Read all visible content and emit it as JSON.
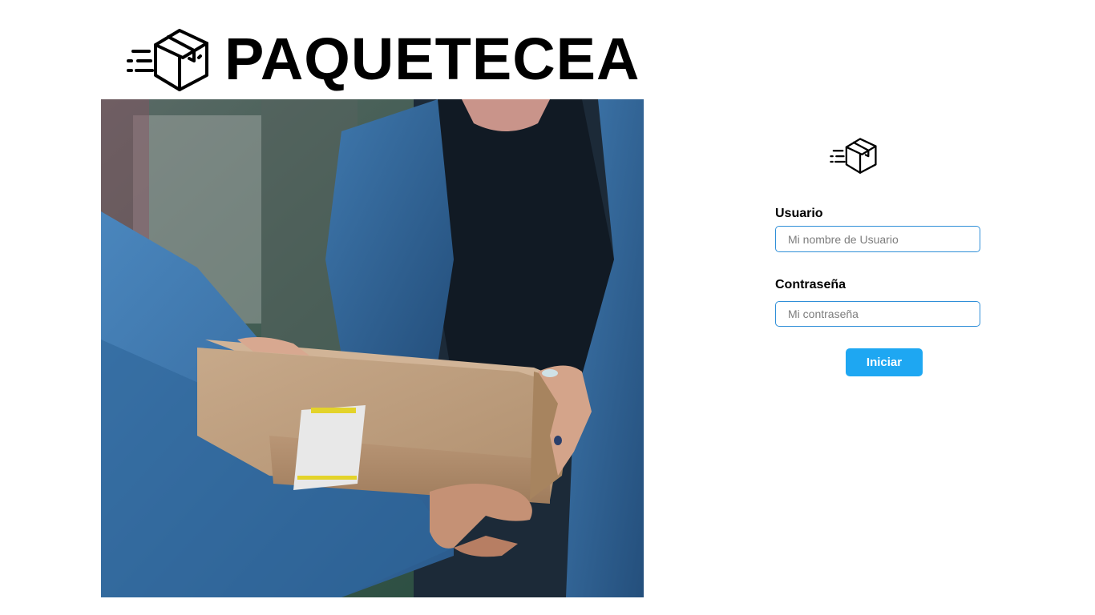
{
  "brand": {
    "name": "PAQUETECEA",
    "logo_icon": "fast-delivery-box-icon"
  },
  "hero": {
    "icon": "package-handover-photo"
  },
  "login": {
    "logo_icon": "fast-delivery-box-icon",
    "username": {
      "label": "Usuario",
      "placeholder": "Mi nombre de Usuario",
      "value": ""
    },
    "password": {
      "label": "Contraseña",
      "placeholder": "Mi contraseña",
      "value": ""
    },
    "submit_label": "Iniciar"
  },
  "colors": {
    "accent": "#1ea7f2",
    "input_border": "#2f8fd8",
    "text": "#000000",
    "background": "#ffffff"
  }
}
